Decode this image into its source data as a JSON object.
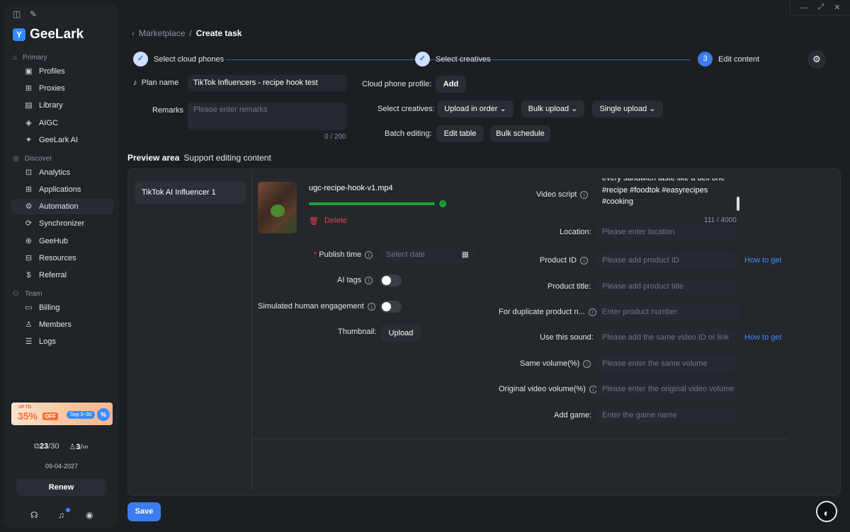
{
  "sidebar": {
    "brand": "GeeLark",
    "sections": {
      "primary": "Primary",
      "discover": "Discover",
      "team": "Team"
    },
    "items": [
      {
        "label": "Profiles",
        "icon": "profiles-icon"
      },
      {
        "label": "Proxies",
        "icon": "proxies-icon"
      },
      {
        "label": "Library",
        "icon": "library-icon"
      },
      {
        "label": "AIGC",
        "icon": "aigc-icon"
      },
      {
        "label": "GeeLark AI",
        "icon": "ai-icon"
      },
      {
        "label": "Analytics",
        "icon": "analytics-icon"
      },
      {
        "label": "Applications",
        "icon": "applications-icon"
      },
      {
        "label": "Automation",
        "icon": "automation-icon"
      },
      {
        "label": "Synchronizer",
        "icon": "synchronizer-icon"
      },
      {
        "label": "GeeHub",
        "icon": "geehub-icon"
      },
      {
        "label": "Resources",
        "icon": "resources-icon"
      },
      {
        "label": "Referral",
        "icon": "referral-icon"
      },
      {
        "label": "Billing",
        "icon": "billing-icon"
      },
      {
        "label": "Members",
        "icon": "members-icon"
      },
      {
        "label": "Logs",
        "icon": "logs-icon"
      }
    ],
    "promo": {
      "top": "UP TO",
      "pct": "35%",
      "off": "OFF",
      "dates": "Sep 3~30",
      "badge": "%"
    },
    "quota": {
      "phones_used": "23",
      "phones_total": "/30",
      "members_used": "3",
      "members_total": "/∞"
    },
    "expiry": "09-04-2027",
    "renew": "Renew"
  },
  "breadcrumb": {
    "parent": "Marketplace",
    "sep": "/",
    "current": "Create task"
  },
  "steps": [
    {
      "label": "Select cloud phones",
      "num": "✓"
    },
    {
      "label": "Select creatives",
      "num": "✓"
    },
    {
      "label": "Edit content",
      "num": "3"
    }
  ],
  "form": {
    "plan_name_label": "Plan name",
    "plan_name": "TikTok Influencers - recipe hook test",
    "remarks_label": "Remarks",
    "remarks_placeholder": "Please enter remarks",
    "remarks_count": "0 / 200",
    "profile_label": "Cloud phone profile:",
    "add": "Add",
    "creatives_label": "Select creatives:",
    "upload_in_order": "Upload in order",
    "bulk_upload": "Bulk upload",
    "single_upload": "Single upload",
    "batch_label": "Batch editing:",
    "edit_table": "Edit table",
    "bulk_schedule": "Bulk schedule"
  },
  "preview": {
    "title": "Preview area",
    "subtitle": "Support editing content",
    "account": "TikTok AI Influencer 1",
    "filename": "ugc-recipe-hook-v1.mp4",
    "upload_progress": 1.0,
    "delete": "Delete",
    "publish_time": "Publish time",
    "publish_placeholder": "Select date",
    "ai_tags": "AI tags",
    "engagement": "Simulated human engagement",
    "thumbnail": "Thumbnail:",
    "thumb_upload": "Upload",
    "video_script": "Video script",
    "script_lines": [
      "every sandwich taste like a deli one",
      "#recipe #foodtok #easyrecipes",
      "#cooking"
    ],
    "script_count": "111 / 4000",
    "location": "Location:",
    "location_ph": "Please enter location",
    "product_id": "Product ID",
    "product_id_ph": "Please add product ID",
    "how_to_get": "How to get",
    "product_title": "Product title:",
    "product_title_ph": "Please add product title",
    "dup_product": "For duplicate product n...",
    "dup_product_ph": "Enter product number",
    "sound": "Use this sound:",
    "sound_ph": "Please add the same video ID or link",
    "same_volume": "Same volume(%)",
    "same_volume_ph": "Please enter the same volume",
    "orig_volume": "Original video volume(%)",
    "orig_volume_ph": "Please enter the original video volume",
    "add_game": "Add game:",
    "add_game_ph": "Enter the game name"
  },
  "save": "Save",
  "colors": {
    "accent": "#3c7cf0",
    "danger": "#e0454b",
    "success": "#19a33a"
  }
}
